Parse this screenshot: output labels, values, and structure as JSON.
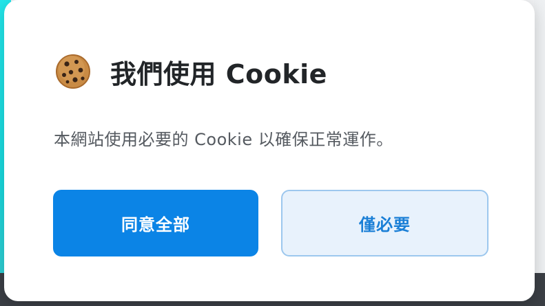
{
  "dialog": {
    "icon": "cookie-icon",
    "title": "我們使用 Cookie",
    "description": "本網站使用必要的 Cookie 以確保正常運作。",
    "buttons": {
      "accept_all": "同意全部",
      "necessary_only": "僅必要"
    }
  },
  "colors": {
    "primary": "#0b84e6",
    "secondary_bg": "#e8f2fc",
    "secondary_text": "#1a7fd6",
    "title_text": "#222528",
    "body_text": "#555a60"
  }
}
